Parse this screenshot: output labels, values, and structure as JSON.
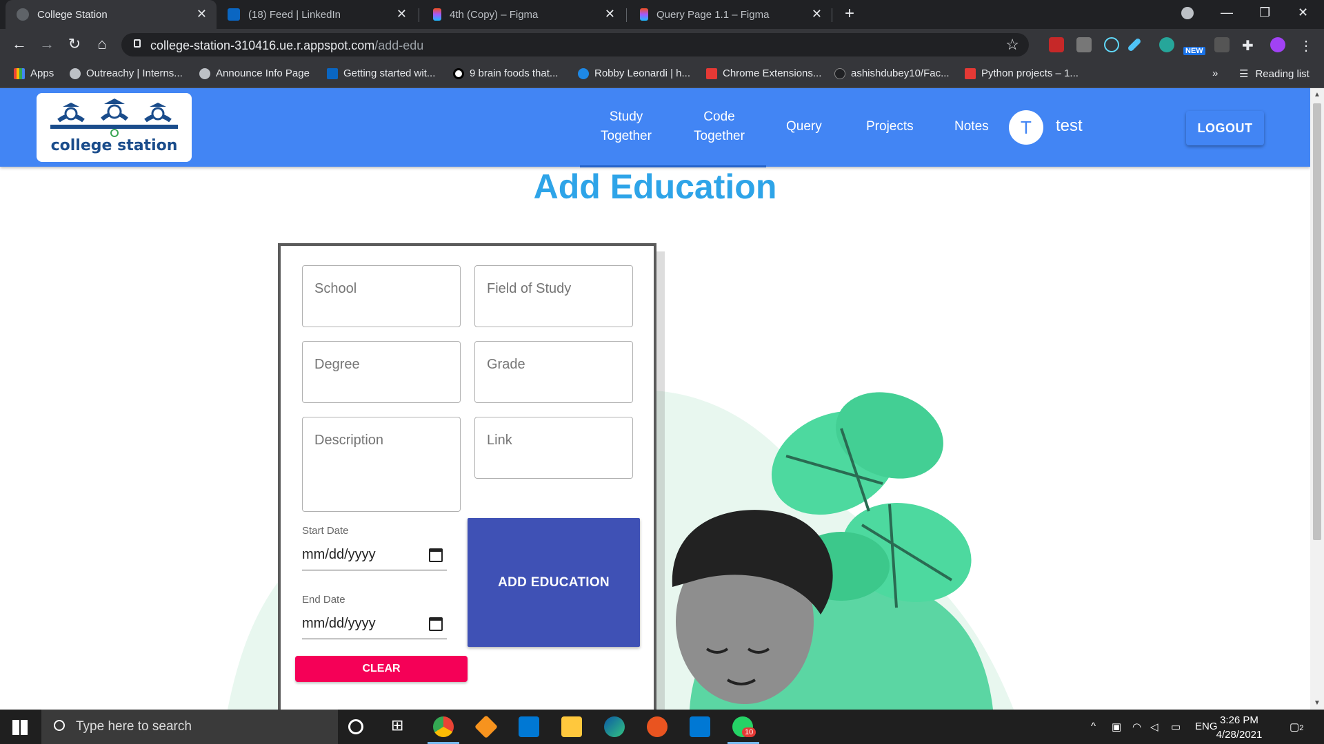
{
  "browser": {
    "tabs": [
      {
        "title": "College Station",
        "active": true
      },
      {
        "title": "(18) Feed | LinkedIn",
        "active": false
      },
      {
        "title": "4th (Copy) – Figma",
        "active": false
      },
      {
        "title": "Query Page 1.1 – Figma",
        "active": false
      }
    ],
    "new_tab": "+",
    "url_host": "college-station-310416.ue.r.appspot.com",
    "url_path": "/add-edu",
    "extension_badge": "NEW",
    "bookmarks": [
      {
        "label": "Apps"
      },
      {
        "label": "Outreachy | Interns..."
      },
      {
        "label": "Announce Info Page"
      },
      {
        "label": "Getting started wit..."
      },
      {
        "label": "9 brain foods that..."
      },
      {
        "label": "Robby Leonardi | h..."
      },
      {
        "label": "Chrome Extensions..."
      },
      {
        "label": "ashishdubey10/Fac..."
      },
      {
        "label": "Python projects – 1..."
      }
    ],
    "bookmarks_overflow": "»",
    "reading_list": "Reading list"
  },
  "navbar": {
    "logo_text": "college station",
    "links": {
      "study_1": "Study",
      "study_2": "Together",
      "code_1": "Code",
      "code_2": "Together",
      "query": "Query",
      "projects": "Projects",
      "notes": "Notes"
    },
    "avatar_letter": "T",
    "username": "test",
    "logout": "LOGOUT"
  },
  "page": {
    "title": "Add Education"
  },
  "form": {
    "school": "School",
    "field_of_study": "Field of Study",
    "degree": "Degree",
    "grade": "Grade",
    "description": "Description",
    "link": "Link",
    "start_date_label": "Start Date",
    "start_date_value": "mm/dd/yyyy",
    "end_date_label": "End Date",
    "end_date_value": "mm/dd/yyyy",
    "add_button": "ADD EDUCATION",
    "clear_button": "CLEAR"
  },
  "taskbar": {
    "search_placeholder": "Type here to search",
    "whatsapp_badge": "10",
    "language": "ENG",
    "time": "3:26 PM",
    "date": "4/28/2021",
    "notification_count": "2"
  },
  "colors": {
    "navbar": "#4285f4",
    "heading": "#2ea4e8",
    "add_button": "#3f51b5",
    "clear_button": "#f50057"
  }
}
